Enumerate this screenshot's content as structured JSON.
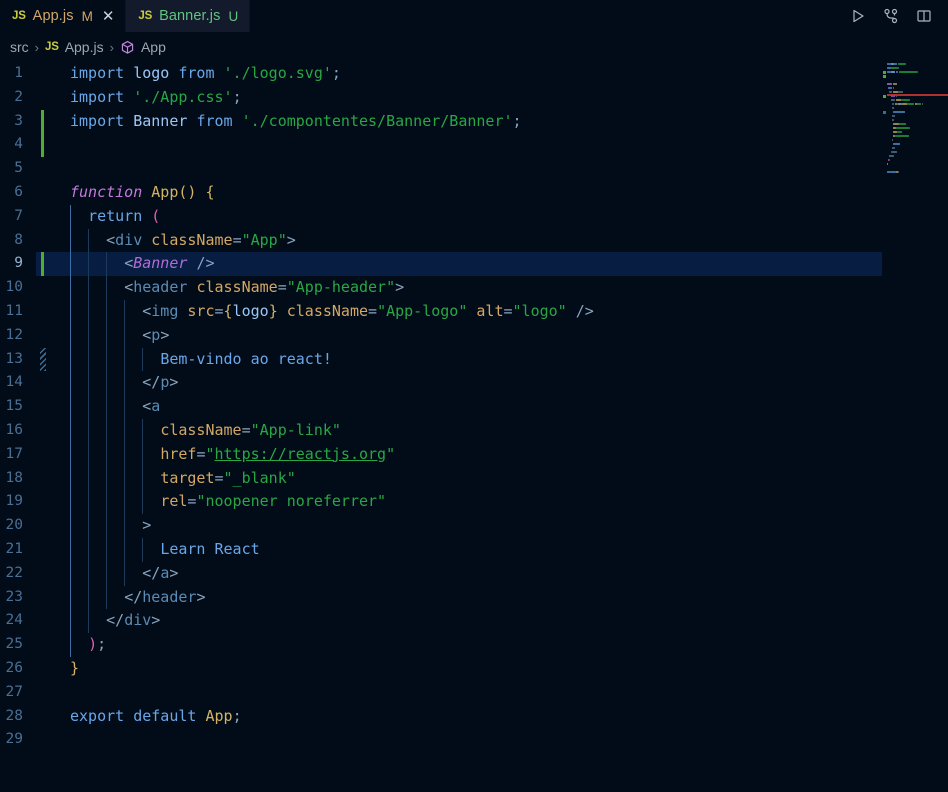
{
  "window": {
    "theme_bg": "#010c18",
    "accent": "#071d42"
  },
  "tabs": [
    {
      "icon": "js-file-icon",
      "badge": "JS",
      "label": "App.js",
      "status": "M",
      "status_title": "Modified",
      "active": false,
      "closable": true,
      "close_glyph": "✕"
    },
    {
      "icon": "js-file-icon",
      "badge": "JS",
      "label": "Banner.js",
      "status": "U",
      "status_title": "Untracked",
      "active": true,
      "closable": false,
      "close_glyph": ""
    }
  ],
  "tab_actions": [
    {
      "name": "run-button",
      "title": "Run or Debug"
    },
    {
      "name": "source-control-fork-icon",
      "title": "Source Control"
    },
    {
      "name": "split-editor-button",
      "title": "Split Editor Right"
    }
  ],
  "breadcrumb": [
    {
      "label": "src",
      "icon": ""
    },
    {
      "label": "App.js",
      "icon": "js-file-icon",
      "badge": "JS"
    },
    {
      "label": "App",
      "icon": "symbol-cube-icon"
    }
  ],
  "breadcrumb_separator": "›",
  "editor": {
    "file": "App.js",
    "language": "javascript",
    "selected_line": 9,
    "total_lines": 29,
    "lines": [
      {
        "n": 1,
        "gutter": "",
        "indent": 0,
        "tokens": [
          {
            "t": "import",
            "c": "kw2"
          },
          {
            "t": " ",
            "c": "punc"
          },
          {
            "t": "logo",
            "c": "var"
          },
          {
            "t": " ",
            "c": "punc"
          },
          {
            "t": "from",
            "c": "kw2"
          },
          {
            "t": " ",
            "c": "punc"
          },
          {
            "t": "'./logo.svg'",
            "c": "str"
          },
          {
            "t": ";",
            "c": "punc"
          }
        ]
      },
      {
        "n": 2,
        "gutter": "",
        "indent": 0,
        "tokens": [
          {
            "t": "import",
            "c": "kw2"
          },
          {
            "t": " ",
            "c": "punc"
          },
          {
            "t": "'./App.css'",
            "c": "str"
          },
          {
            "t": ";",
            "c": "punc"
          }
        ]
      },
      {
        "n": 3,
        "gutter": "added",
        "indent": 0,
        "tokens": [
          {
            "t": "import",
            "c": "kw2"
          },
          {
            "t": " ",
            "c": "punc"
          },
          {
            "t": "Banner",
            "c": "var"
          },
          {
            "t": " ",
            "c": "punc"
          },
          {
            "t": "from",
            "c": "kw2"
          },
          {
            "t": " ",
            "c": "punc"
          },
          {
            "t": "'./compontentes/Banner/Banner'",
            "c": "str"
          },
          {
            "t": ";",
            "c": "punc"
          }
        ]
      },
      {
        "n": 4,
        "gutter": "added",
        "indent": 0,
        "tokens": []
      },
      {
        "n": 5,
        "gutter": "",
        "indent": 0,
        "tokens": []
      },
      {
        "n": 6,
        "gutter": "",
        "indent": 0,
        "tokens": [
          {
            "t": "function",
            "c": "kw"
          },
          {
            "t": " ",
            "c": "punc"
          },
          {
            "t": "App",
            "c": "fn"
          },
          {
            "t": "()",
            "c": "paren-y"
          },
          {
            "t": " ",
            "c": "punc"
          },
          {
            "t": "{",
            "c": "paren-y"
          }
        ]
      },
      {
        "n": 7,
        "gutter": "",
        "indent": 1,
        "tokens": [
          {
            "t": "  ",
            "c": "punc"
          },
          {
            "t": "return",
            "c": "kw2"
          },
          {
            "t": " ",
            "c": "punc"
          },
          {
            "t": "(",
            "c": "paren-p"
          }
        ]
      },
      {
        "n": 8,
        "gutter": "",
        "indent": 2,
        "tokens": [
          {
            "t": "    ",
            "c": "punc"
          },
          {
            "t": "<",
            "c": "punc"
          },
          {
            "t": "div",
            "c": "tag"
          },
          {
            "t": " ",
            "c": "punc"
          },
          {
            "t": "className",
            "c": "attr"
          },
          {
            "t": "=",
            "c": "punc"
          },
          {
            "t": "\"App\"",
            "c": "str"
          },
          {
            "t": ">",
            "c": "punc"
          }
        ]
      },
      {
        "n": 9,
        "gutter": "added",
        "indent": 3,
        "selected": true,
        "tokens": [
          {
            "t": "      ",
            "c": "punc"
          },
          {
            "t": "<",
            "c": "punc"
          },
          {
            "t": "Banner",
            "c": "comp"
          },
          {
            "t": " ",
            "c": "punc"
          },
          {
            "t": "/>",
            "c": "punc"
          }
        ]
      },
      {
        "n": 10,
        "gutter": "",
        "indent": 3,
        "tokens": [
          {
            "t": "      ",
            "c": "punc"
          },
          {
            "t": "<",
            "c": "punc"
          },
          {
            "t": "header",
            "c": "tag"
          },
          {
            "t": " ",
            "c": "punc"
          },
          {
            "t": "className",
            "c": "attr"
          },
          {
            "t": "=",
            "c": "punc"
          },
          {
            "t": "\"App-header\"",
            "c": "str"
          },
          {
            "t": ">",
            "c": "punc"
          }
        ]
      },
      {
        "n": 11,
        "gutter": "",
        "indent": 4,
        "tokens": [
          {
            "t": "        ",
            "c": "punc"
          },
          {
            "t": "<",
            "c": "punc"
          },
          {
            "t": "img",
            "c": "tag"
          },
          {
            "t": " ",
            "c": "punc"
          },
          {
            "t": "src",
            "c": "attr"
          },
          {
            "t": "=",
            "c": "punc"
          },
          {
            "t": "{",
            "c": "paren-y"
          },
          {
            "t": "logo",
            "c": "var"
          },
          {
            "t": "}",
            "c": "paren-y"
          },
          {
            "t": " ",
            "c": "punc"
          },
          {
            "t": "className",
            "c": "attr"
          },
          {
            "t": "=",
            "c": "punc"
          },
          {
            "t": "\"App-logo\"",
            "c": "str"
          },
          {
            "t": " ",
            "c": "punc"
          },
          {
            "t": "alt",
            "c": "attr"
          },
          {
            "t": "=",
            "c": "punc"
          },
          {
            "t": "\"logo\"",
            "c": "str"
          },
          {
            "t": " ",
            "c": "punc"
          },
          {
            "t": "/>",
            "c": "punc"
          }
        ]
      },
      {
        "n": 12,
        "gutter": "",
        "indent": 4,
        "tokens": [
          {
            "t": "        ",
            "c": "punc"
          },
          {
            "t": "<",
            "c": "punc"
          },
          {
            "t": "p",
            "c": "tag"
          },
          {
            "t": ">",
            "c": "punc"
          }
        ]
      },
      {
        "n": 13,
        "gutter": "deleted",
        "indent": 5,
        "tokens": [
          {
            "t": "          ",
            "c": "punc"
          },
          {
            "t": "Bem-vindo ao react!",
            "c": "txt"
          }
        ]
      },
      {
        "n": 14,
        "gutter": "",
        "indent": 4,
        "tokens": [
          {
            "t": "        ",
            "c": "punc"
          },
          {
            "t": "</",
            "c": "punc"
          },
          {
            "t": "p",
            "c": "tag"
          },
          {
            "t": ">",
            "c": "punc"
          }
        ]
      },
      {
        "n": 15,
        "gutter": "",
        "indent": 4,
        "tokens": [
          {
            "t": "        ",
            "c": "punc"
          },
          {
            "t": "<",
            "c": "punc"
          },
          {
            "t": "a",
            "c": "tag"
          }
        ]
      },
      {
        "n": 16,
        "gutter": "",
        "indent": 5,
        "tokens": [
          {
            "t": "          ",
            "c": "punc"
          },
          {
            "t": "className",
            "c": "attr"
          },
          {
            "t": "=",
            "c": "punc"
          },
          {
            "t": "\"App-link\"",
            "c": "str"
          }
        ]
      },
      {
        "n": 17,
        "gutter": "",
        "indent": 5,
        "tokens": [
          {
            "t": "          ",
            "c": "punc"
          },
          {
            "t": "href",
            "c": "attr"
          },
          {
            "t": "=",
            "c": "punc"
          },
          {
            "t": "\"",
            "c": "str"
          },
          {
            "t": "https://reactjs.org",
            "c": "link"
          },
          {
            "t": "\"",
            "c": "str"
          }
        ]
      },
      {
        "n": 18,
        "gutter": "",
        "indent": 5,
        "tokens": [
          {
            "t": "          ",
            "c": "punc"
          },
          {
            "t": "target",
            "c": "attr"
          },
          {
            "t": "=",
            "c": "punc"
          },
          {
            "t": "\"_blank\"",
            "c": "str"
          }
        ]
      },
      {
        "n": 19,
        "gutter": "",
        "indent": 5,
        "tokens": [
          {
            "t": "          ",
            "c": "punc"
          },
          {
            "t": "rel",
            "c": "attr"
          },
          {
            "t": "=",
            "c": "punc"
          },
          {
            "t": "\"noopener noreferrer\"",
            "c": "str"
          }
        ]
      },
      {
        "n": 20,
        "gutter": "",
        "indent": 4,
        "tokens": [
          {
            "t": "        ",
            "c": "punc"
          },
          {
            "t": ">",
            "c": "punc"
          }
        ]
      },
      {
        "n": 21,
        "gutter": "",
        "indent": 5,
        "tokens": [
          {
            "t": "          ",
            "c": "punc"
          },
          {
            "t": "Learn React",
            "c": "txt"
          }
        ]
      },
      {
        "n": 22,
        "gutter": "",
        "indent": 4,
        "tokens": [
          {
            "t": "        ",
            "c": "punc"
          },
          {
            "t": "</",
            "c": "punc"
          },
          {
            "t": "a",
            "c": "tag"
          },
          {
            "t": ">",
            "c": "punc"
          }
        ]
      },
      {
        "n": 23,
        "gutter": "",
        "indent": 3,
        "tokens": [
          {
            "t": "      ",
            "c": "punc"
          },
          {
            "t": "</",
            "c": "punc"
          },
          {
            "t": "header",
            "c": "tag"
          },
          {
            "t": ">",
            "c": "punc"
          }
        ]
      },
      {
        "n": 24,
        "gutter": "",
        "indent": 2,
        "tokens": [
          {
            "t": "    ",
            "c": "punc"
          },
          {
            "t": "</",
            "c": "punc"
          },
          {
            "t": "div",
            "c": "tag"
          },
          {
            "t": ">",
            "c": "punc"
          }
        ]
      },
      {
        "n": 25,
        "gutter": "",
        "indent": 1,
        "tokens": [
          {
            "t": "  ",
            "c": "punc"
          },
          {
            "t": ")",
            "c": "paren-p"
          },
          {
            "t": ";",
            "c": "punc"
          }
        ]
      },
      {
        "n": 26,
        "gutter": "",
        "indent": 0,
        "tokens": [
          {
            "t": "}",
            "c": "paren-y"
          }
        ]
      },
      {
        "n": 27,
        "gutter": "",
        "indent": 0,
        "tokens": []
      },
      {
        "n": 28,
        "gutter": "",
        "indent": 0,
        "tokens": [
          {
            "t": "export",
            "c": "kw2"
          },
          {
            "t": " ",
            "c": "punc"
          },
          {
            "t": "default",
            "c": "kw2"
          },
          {
            "t": " ",
            "c": "punc"
          },
          {
            "t": "App",
            "c": "fn"
          },
          {
            "t": ";",
            "c": "punc"
          }
        ]
      },
      {
        "n": 29,
        "gutter": "",
        "indent": 0,
        "tokens": []
      }
    ]
  },
  "minimap": {
    "visible": true,
    "selected_line_marker_color": "#b03030"
  }
}
